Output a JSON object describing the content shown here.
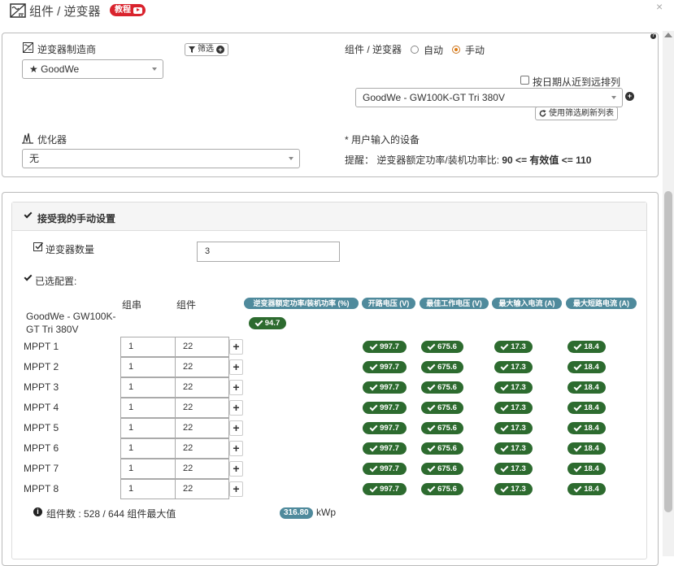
{
  "header": {
    "title": "组件 / 逆变器",
    "tutorial_badge": "教程",
    "close_label": "×"
  },
  "inverter": {
    "manufacturer_label": "逆变器制造商",
    "manufacturer_value": "★ GoodWe",
    "filter_label": "筛选",
    "mode_label": "组件 / 逆变器",
    "mode_auto": "自动",
    "mode_manual": "手动",
    "mode_selected": "手动",
    "sort_checkbox_label": "按日期从近到远排列",
    "model_value": "GoodWe - GW100K-GT Tri 380V",
    "refresh_button": "使用筛选刷新列表",
    "optimizer_label": "优化器",
    "optimizer_value": "无",
    "user_input_note": "* 用户输入的设备",
    "hint_prefix": "提醒：",
    "hint_text": "逆变器额定功率/装机功率比:",
    "hint_range": "90 <= 有效值 <= 110"
  },
  "manual": {
    "panel_title": "接受我的手动设置",
    "inverter_count_label": "逆变器数量",
    "inverter_count_value": "3",
    "selected_config_label": "已选配置:",
    "col_strings": "组串",
    "col_modules": "组件",
    "hdr_ratio": "逆变器额定功率/装机功率 (%)",
    "hdr_voc": "开路电压 (V)",
    "hdr_vmp": "最佳工作电压 (V)",
    "hdr_imax": "最大输入电流 (A)",
    "hdr_isc": "最大短路电流 (A)",
    "inverter_name": "GoodWe - GW100K-GT Tri 380V",
    "ratio_value": "94.7",
    "mppts": [
      {
        "label": "MPPT 1",
        "strings": "1",
        "modules": "22",
        "voc": "997.7",
        "vmp": "675.6",
        "imax": "17.3",
        "isc": "18.4"
      },
      {
        "label": "MPPT 2",
        "strings": "1",
        "modules": "22",
        "voc": "997.7",
        "vmp": "675.6",
        "imax": "17.3",
        "isc": "18.4"
      },
      {
        "label": "MPPT 3",
        "strings": "1",
        "modules": "22",
        "voc": "997.7",
        "vmp": "675.6",
        "imax": "17.3",
        "isc": "18.4"
      },
      {
        "label": "MPPT 4",
        "strings": "1",
        "modules": "22",
        "voc": "997.7",
        "vmp": "675.6",
        "imax": "17.3",
        "isc": "18.4"
      },
      {
        "label": "MPPT 5",
        "strings": "1",
        "modules": "22",
        "voc": "997.7",
        "vmp": "675.6",
        "imax": "17.3",
        "isc": "18.4"
      },
      {
        "label": "MPPT 6",
        "strings": "1",
        "modules": "22",
        "voc": "997.7",
        "vmp": "675.6",
        "imax": "17.3",
        "isc": "18.4"
      },
      {
        "label": "MPPT 7",
        "strings": "1",
        "modules": "22",
        "voc": "997.7",
        "vmp": "675.6",
        "imax": "17.3",
        "isc": "18.4"
      },
      {
        "label": "MPPT 8",
        "strings": "1",
        "modules": "22",
        "voc": "997.7",
        "vmp": "675.6",
        "imax": "17.3",
        "isc": "18.4"
      }
    ],
    "module_count_text": "组件数 : 528 / 644 组件最大值",
    "total_power_value": "316.80",
    "total_power_unit": "kWp"
  },
  "colors": {
    "accent_red": "#d9232d",
    "badge_green": "#2d6b2f",
    "header_teal": "#4f8a9c",
    "radio_orange": "#e07b10"
  }
}
